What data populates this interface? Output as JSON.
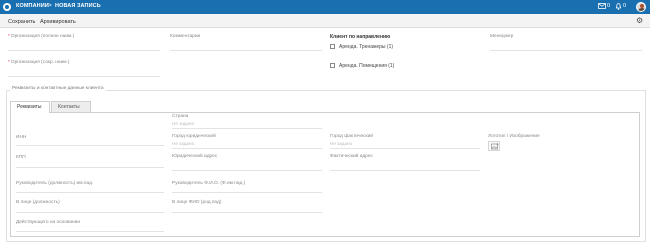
{
  "topbar": {
    "breadcrumb": [
      "КОМПАНИИ",
      "НОВАЯ ЗАПИСЬ"
    ],
    "separator": ">",
    "mail_count": "0",
    "notify_count": "0"
  },
  "toolbar": {
    "save_label": "Сохранить",
    "archive_label": "Архивировать"
  },
  "form": {
    "org_full_label": "Организация (полное наим.)",
    "org_short_label": "Организация (сокр. наим.)",
    "comment_label": "Комментарии",
    "client_direction_label": "Клиент по направлению",
    "rent_simulators_label": "Аренда. Тренажеры (1)",
    "rent_premises_label": "Аренда. Помещения (1)",
    "manager_label": "Менеджер"
  },
  "requisites": {
    "section_title": "Реквизиты и контактные данные клиента",
    "tabs": [
      "Реквизиты",
      "Контакты"
    ],
    "country_label": "Страна",
    "country_hint": "Не задано",
    "inn_label": "ИНН",
    "kpp_label": "КПП",
    "legal_city_label": "Город юридический",
    "legal_city_hint": "Не задано",
    "actual_city_label": "Город фактический",
    "actual_city_hint": "Не задано",
    "logo_label": "Логотип / Изображение",
    "legal_address_label": "Юридический адрес",
    "actual_address_label": "Фактический адрес",
    "head_position_label": "Руководитель (должность) им.пад.",
    "head_name_label": "Руководитель Ф.И.О. (Ф.им.пад.)",
    "person_position_label": "В лице (должность)",
    "person_name_label": "В лице ФИО (род.пад)",
    "acting_basis_label": "Действующего на основании"
  },
  "colors": {
    "brand": "#1a6fb0",
    "required": "#dd2233"
  }
}
